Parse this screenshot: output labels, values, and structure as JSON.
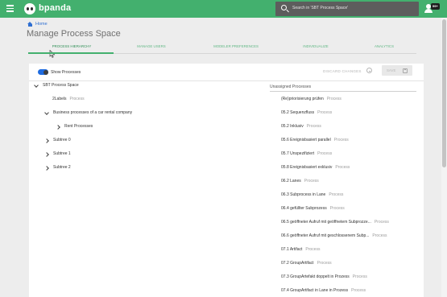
{
  "header": {
    "brand": "bpanda",
    "search_text": "Search in 'SBT Process Space'",
    "badge": "99+"
  },
  "breadcrumb": {
    "home": "Home"
  },
  "page_title": "Manage Process Space",
  "tabs": [
    {
      "label": "PROCESS HIERARCHY",
      "active": true
    },
    {
      "label": "MANAGE USERS"
    },
    {
      "label": "MODELER PREFERENCES"
    },
    {
      "label": "INDIVIDUALIZE"
    },
    {
      "label": "ANALYTICS"
    }
  ],
  "toolbar": {
    "show_processes": "Show Processes",
    "show_processes_on": true,
    "discard": "DISCARD CHANGES",
    "save": "SAVE"
  },
  "tree": [
    {
      "label": "SBT Process Space",
      "type": "",
      "expanded": true
    },
    {
      "label": "2Labels",
      "type": "Process"
    },
    {
      "label": "Business processes of a car rental company",
      "type": "",
      "expanded": true
    },
    {
      "label": "Rent Processes",
      "type": ""
    },
    {
      "label": "Subtree 0",
      "type": ""
    },
    {
      "label": "Subtree 1",
      "type": ""
    },
    {
      "label": "Subtree 2",
      "type": ""
    }
  ],
  "unassigned": {
    "title": "Unassigned Processes",
    "items": [
      {
        "name": "(Re)priorisierung prüfen",
        "type": "Process"
      },
      {
        "name": "05.2 Sequenzfluss",
        "type": "Process"
      },
      {
        "name": "05.2 Inklusiv",
        "type": "Process"
      },
      {
        "name": "05.6 Ereignisbasiert parallel",
        "type": "Process"
      },
      {
        "name": "05.7 Unspezifiziert",
        "type": "Process"
      },
      {
        "name": "05.8 Ereignisbasiert exklusiv",
        "type": "Process"
      },
      {
        "name": "06.2 Lanes",
        "type": "Process"
      },
      {
        "name": "06.3 Subprocess in Lane",
        "type": "Process"
      },
      {
        "name": "06.4 gefüllter Subprozess",
        "type": "Process"
      },
      {
        "name": "06.5 geöffneter Aufruf mit geöffnetem Subprozze...",
        "type": "Process"
      },
      {
        "name": "06.6 geöffneter Aufruf mit geschlossenem Subp...",
        "type": "Process"
      },
      {
        "name": "07.1 Artifact",
        "type": "Process"
      },
      {
        "name": "07.2 GroupArtifact",
        "type": "Process"
      },
      {
        "name": "07.3 GroupArtefakt doppelt in Prozess",
        "type": "Process"
      },
      {
        "name": "07.4 GroupArtifact in Lane in Prozess",
        "type": "Process"
      }
    ]
  },
  "colors": {
    "topbar": "#43b06e",
    "link": "#2f6fd1",
    "toggle": "#1e6be0"
  }
}
